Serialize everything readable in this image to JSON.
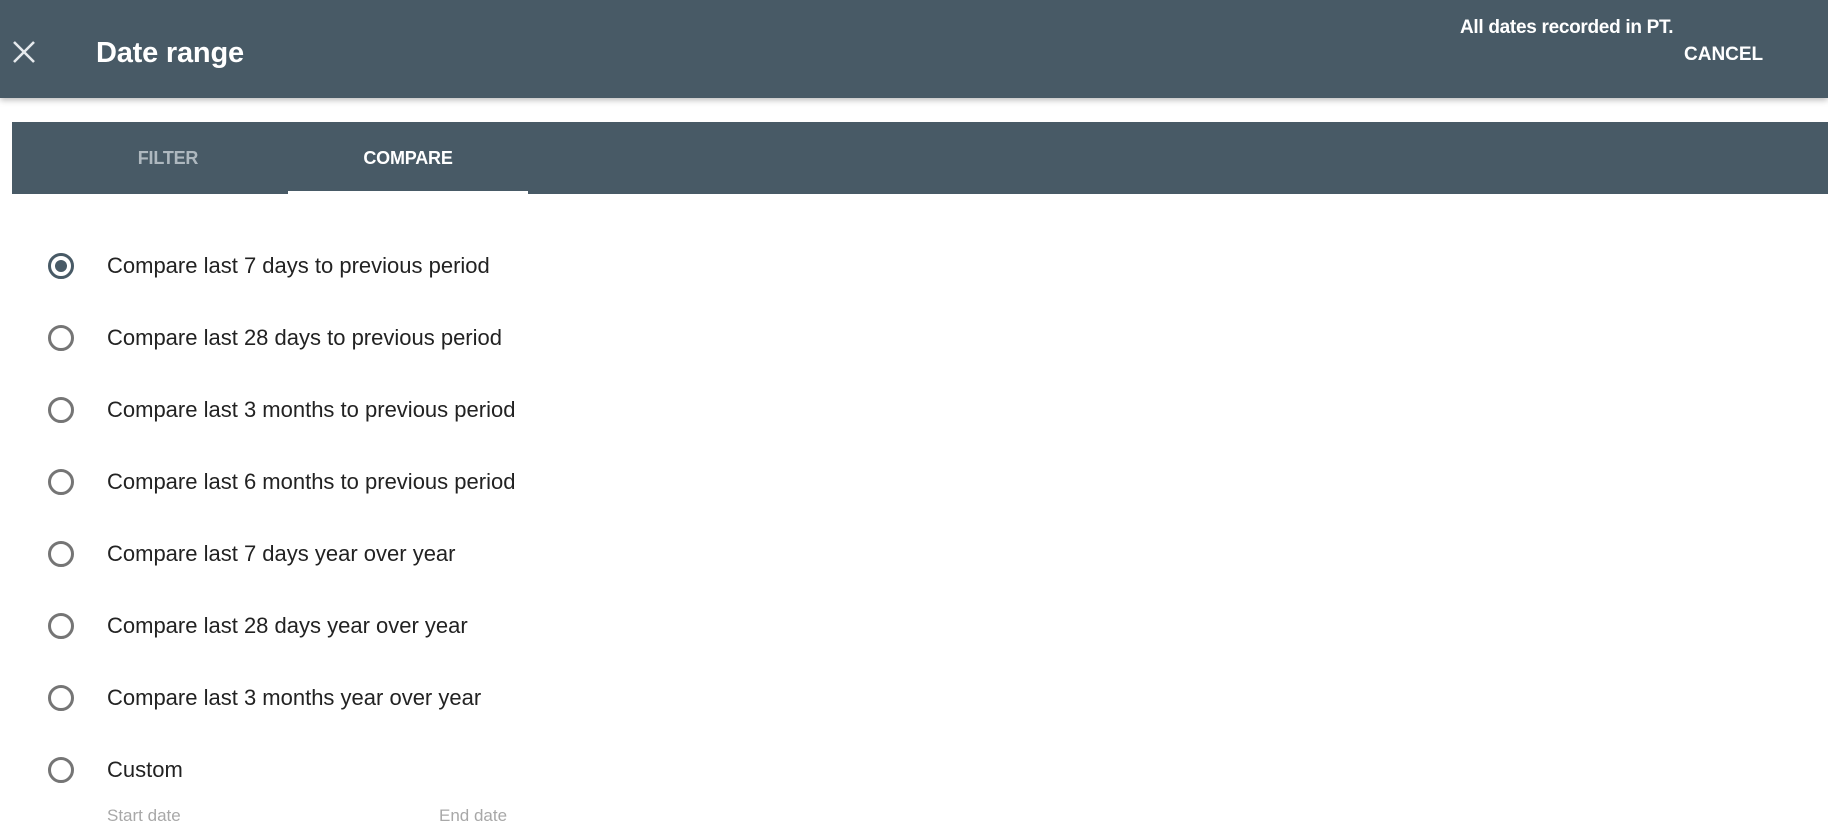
{
  "header": {
    "close_icon": "close-icon",
    "title": "Date range",
    "timezone_note": "All dates recorded in PT.",
    "cancel_label": "CANCEL"
  },
  "tabs": [
    {
      "label": "FILTER",
      "active": false
    },
    {
      "label": "COMPARE",
      "active": true
    }
  ],
  "compare_options": [
    {
      "label": "Compare last 7 days to previous period",
      "selected": true
    },
    {
      "label": "Compare last 28 days to previous period",
      "selected": false
    },
    {
      "label": "Compare last 3 months to previous period",
      "selected": false
    },
    {
      "label": "Compare last 6 months to previous period",
      "selected": false
    },
    {
      "label": "Compare last 7 days year over year",
      "selected": false
    },
    {
      "label": "Compare last 28 days year over year",
      "selected": false
    },
    {
      "label": "Compare last 3 months year over year",
      "selected": false
    },
    {
      "label": "Custom",
      "selected": false
    }
  ],
  "custom": {
    "start_date_placeholder": "Start date",
    "end_date_placeholder": "End date"
  },
  "colors": {
    "header_bg": "#485a66",
    "tab_inactive_text": "#aeb8bf",
    "radio_selected": "#485a66",
    "radio_unselected": "#757575"
  }
}
